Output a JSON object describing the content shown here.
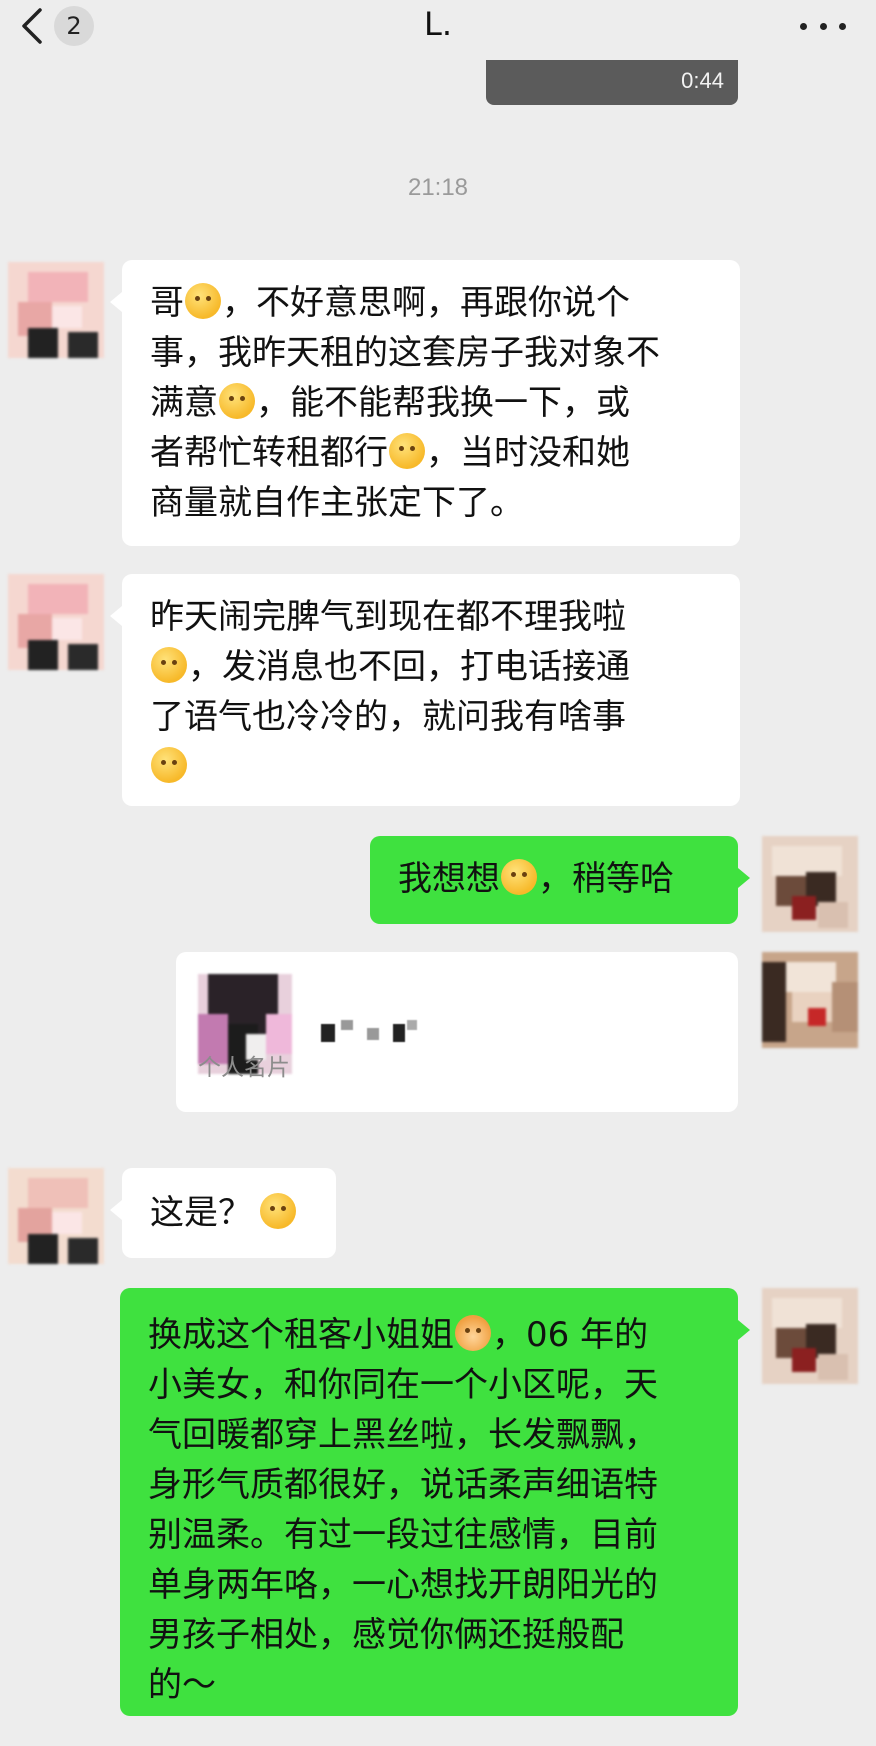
{
  "header": {
    "back_count": "2",
    "title": "L."
  },
  "video": {
    "duration": "0:44"
  },
  "timestamp": "21:18",
  "messages": [
    {
      "side": "left",
      "parts": [
        "哥",
        "emoji:pensive",
        "，不好意思啊，再跟你说个事，我昨天租的这套房子我对象不满意",
        "emoji:sigh",
        "，能不能帮我换一下，或者帮忙转租都行",
        "emoji:sad-sweat",
        "，当时没和她商量就自作主张定下了。"
      ]
    },
    {
      "side": "left",
      "parts": [
        "昨天闹完脾气到现在都不理我啦",
        "emoji:pleading",
        "，发消息也不回，打电话接通了语气也冷冷的，就问我有啥事",
        "emoji:slightly-frowning"
      ]
    },
    {
      "side": "right",
      "parts": [
        "我想想",
        "emoji:thinking",
        "，稍等哈"
      ]
    },
    {
      "side": "right",
      "type": "contact-card",
      "label": "个人名片"
    },
    {
      "side": "left",
      "parts": [
        "这是？",
        "emoji:raised-eyebrow"
      ]
    },
    {
      "side": "right",
      "parts": [
        "换成这个租客小姐姐",
        "emoji:person",
        "，06年的小美女，和你同在一个小区呢，天气回暖都穿上黑丝啦，长发飘飘，身形气质都很好，说话柔声细语特别温柔。有过一段过往感情，目前单身两年咯，一心想找开朗阳光的男孩子相处，感觉你俩还挺般配的～"
      ]
    }
  ],
  "text": {
    "m1_a": "哥",
    "m1_b": "，不好意思啊，再跟你说个",
    "m1_c": "事，我昨天租的这套房子我对象不",
    "m1_d": "满意",
    "m1_e": "，能不能帮我换一下，或",
    "m1_f": "者帮忙转租都行",
    "m1_g": "，当时没和她",
    "m1_h": "商量就自作主张定下了。",
    "m2_a": "昨天闹完脾气到现在都不理我啦",
    "m2_b": "，发消息也不回，打电话接通",
    "m2_c": "了语气也冷冷的，就问我有啥事",
    "m3_a": "我想想",
    "m3_b": "，稍等哈",
    "m5_a": "这是？",
    "m6_a": "换成这个租客小姐姐",
    "m6_b": "，06 年的",
    "m6_c": "小美女，和你同在一个小区呢，天",
    "m6_d": "气回暖都穿上黑丝啦，长发飘飘，",
    "m6_e": "身形气质都很好，说话柔声细语特",
    "m6_f": "别温柔。有过一段过往感情，目前",
    "m6_g": "单身两年咯，一心想找开朗阳光的",
    "m6_h": "男孩子相处，感觉你俩还挺般配",
    "m6_i": "的～",
    "card_label": "个人名片"
  },
  "icons": {
    "back": "chevron-left-icon",
    "more": "more-dots-icon"
  },
  "colors": {
    "background": "#ededed",
    "incoming_bubble": "#ffffff",
    "outgoing_bubble": "#3fe13f",
    "timestamp": "#9a9a9a"
  }
}
